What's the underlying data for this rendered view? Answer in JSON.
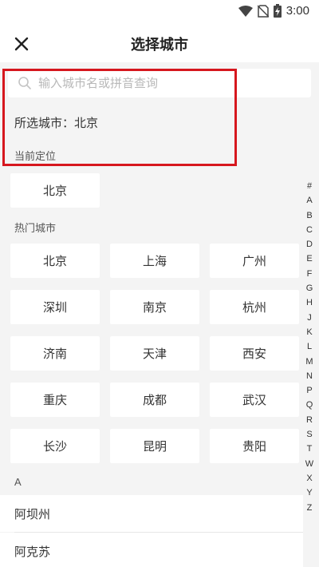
{
  "status": {
    "time": "3:00"
  },
  "header": {
    "title": "选择城市"
  },
  "search": {
    "placeholder": "输入城市名或拼音查询"
  },
  "selected": {
    "prefix": "所选城市：",
    "city": "北京"
  },
  "current_location": {
    "label": "当前定位",
    "city": "北京"
  },
  "hot_cities": {
    "label": "热门城市",
    "items": [
      "北京",
      "上海",
      "广州",
      "深圳",
      "南京",
      "杭州",
      "济南",
      "天津",
      "西安",
      "重庆",
      "成都",
      "武汉",
      "长沙",
      "昆明",
      "贵阳"
    ]
  },
  "index_letters": [
    "#",
    "A",
    "B",
    "C",
    "D",
    "E",
    "F",
    "G",
    "H",
    "J",
    "K",
    "L",
    "M",
    "N",
    "P",
    "Q",
    "R",
    "S",
    "T",
    "W",
    "X",
    "Y",
    "Z"
  ],
  "city_list": {
    "letter": "A",
    "items": [
      "阿坝州",
      "阿克苏"
    ]
  },
  "colors": {
    "highlight": "#d6171e",
    "background": "#f4f4f4"
  }
}
